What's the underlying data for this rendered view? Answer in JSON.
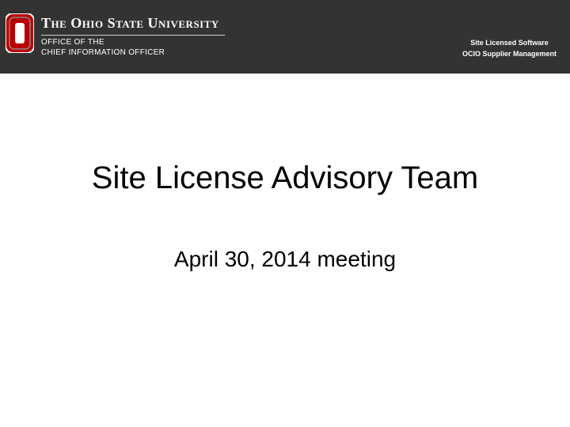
{
  "header": {
    "university_name": "The Ohio State University",
    "office_line_1": "Office of the",
    "office_line_2": "Chief Information Officer",
    "right_line_1": "Site Licensed Software",
    "right_line_2": "OCIO Supplier Management",
    "background_color": "#333333",
    "logo_icon": "block-o-logo-icon",
    "logo_color": "#bb0000"
  },
  "slide": {
    "title": "Site License Advisory Team",
    "subtitle": "April 30, 2014 meeting"
  }
}
